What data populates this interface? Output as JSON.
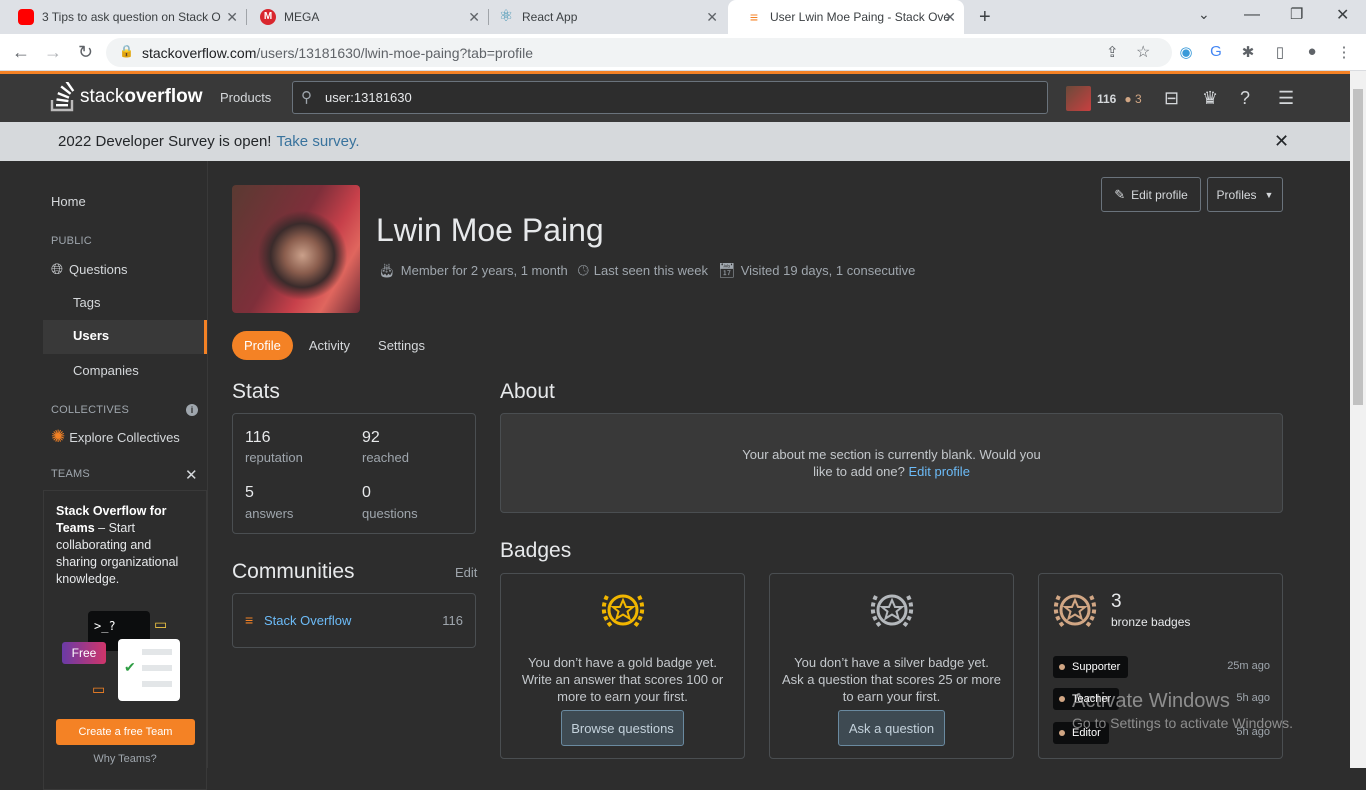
{
  "browser": {
    "tabs": [
      {
        "title": "3 Tips to ask question on Stack O",
        "icon": "youtube-icon",
        "color": "#ff0000"
      },
      {
        "title": "MEGA",
        "icon": "mega-icon",
        "color": "#d9272e"
      },
      {
        "title": "React App",
        "icon": "react-icon",
        "color": "#61dafb"
      },
      {
        "title": "User Lwin Moe Paing - Stack Ove",
        "icon": "stackoverflow-icon",
        "color": "#f48225"
      }
    ],
    "url_host": "stackoverflow.com",
    "url_path": "/users/13181630/lwin-moe-paing?tab=profile"
  },
  "topbar": {
    "logo_text_light": "stack",
    "logo_text_bold": "overflow",
    "products": "Products",
    "search_value": "user:13181630",
    "reputation": "116",
    "bronze_count": "3"
  },
  "banner": {
    "text": "2022 Developer Survey is open!",
    "link": "Take survey."
  },
  "sidebar": {
    "home": "Home",
    "public": "PUBLIC",
    "questions": "Questions",
    "tags": "Tags",
    "users": "Users",
    "companies": "Companies",
    "collectives": "COLLECTIVES",
    "explore_collectives": "Explore Collectives",
    "teams": "TEAMS",
    "teams_title": "Stack Overflow for Teams",
    "teams_desc": " – Start collaborating and sharing organizational knowledge.",
    "teams_free": "Free",
    "teams_prompt": ">_?",
    "teams_cta": "Create a free Team",
    "teams_why": "Why Teams?"
  },
  "profile": {
    "name": "Lwin Moe Paing",
    "member_for": "Member for 2 years, 1 month",
    "last_seen": "Last seen this week",
    "visited": "Visited 19 days, 1 consecutive",
    "edit_profile": "Edit profile",
    "profiles": "Profiles",
    "tabs": [
      "Profile",
      "Activity",
      "Settings"
    ]
  },
  "stats": {
    "heading": "Stats",
    "items": [
      {
        "value": "116",
        "label": "reputation"
      },
      {
        "value": "92",
        "label": "reached"
      },
      {
        "value": "5",
        "label": "answers"
      },
      {
        "value": "0",
        "label": "questions"
      }
    ]
  },
  "communities": {
    "heading": "Communities",
    "edit": "Edit",
    "name": "Stack Overflow",
    "rep": "116"
  },
  "about": {
    "heading": "About",
    "text": "Your about me section is currently blank. Would you like to add one?",
    "link": "Edit profile"
  },
  "badges": {
    "heading": "Badges",
    "gold_text": "You don’t have a gold badge yet. Write an answer that scores 100 or more to earn your first.",
    "gold_btn": "Browse questions",
    "silver_text": "You don’t have a silver badge yet. Ask a question that scores 25 or more to earn your first.",
    "silver_btn": "Ask a question",
    "bronze_count": "3",
    "bronze_label": "bronze badges",
    "bronze_list": [
      {
        "name": "Supporter",
        "ago": "25m ago"
      },
      {
        "name": "Teacher",
        "ago": "5h ago"
      },
      {
        "name": "Editor",
        "ago": "5h ago"
      }
    ]
  },
  "watermark": {
    "line1": "Activate Windows",
    "line2": "Go to Settings to activate Windows."
  }
}
